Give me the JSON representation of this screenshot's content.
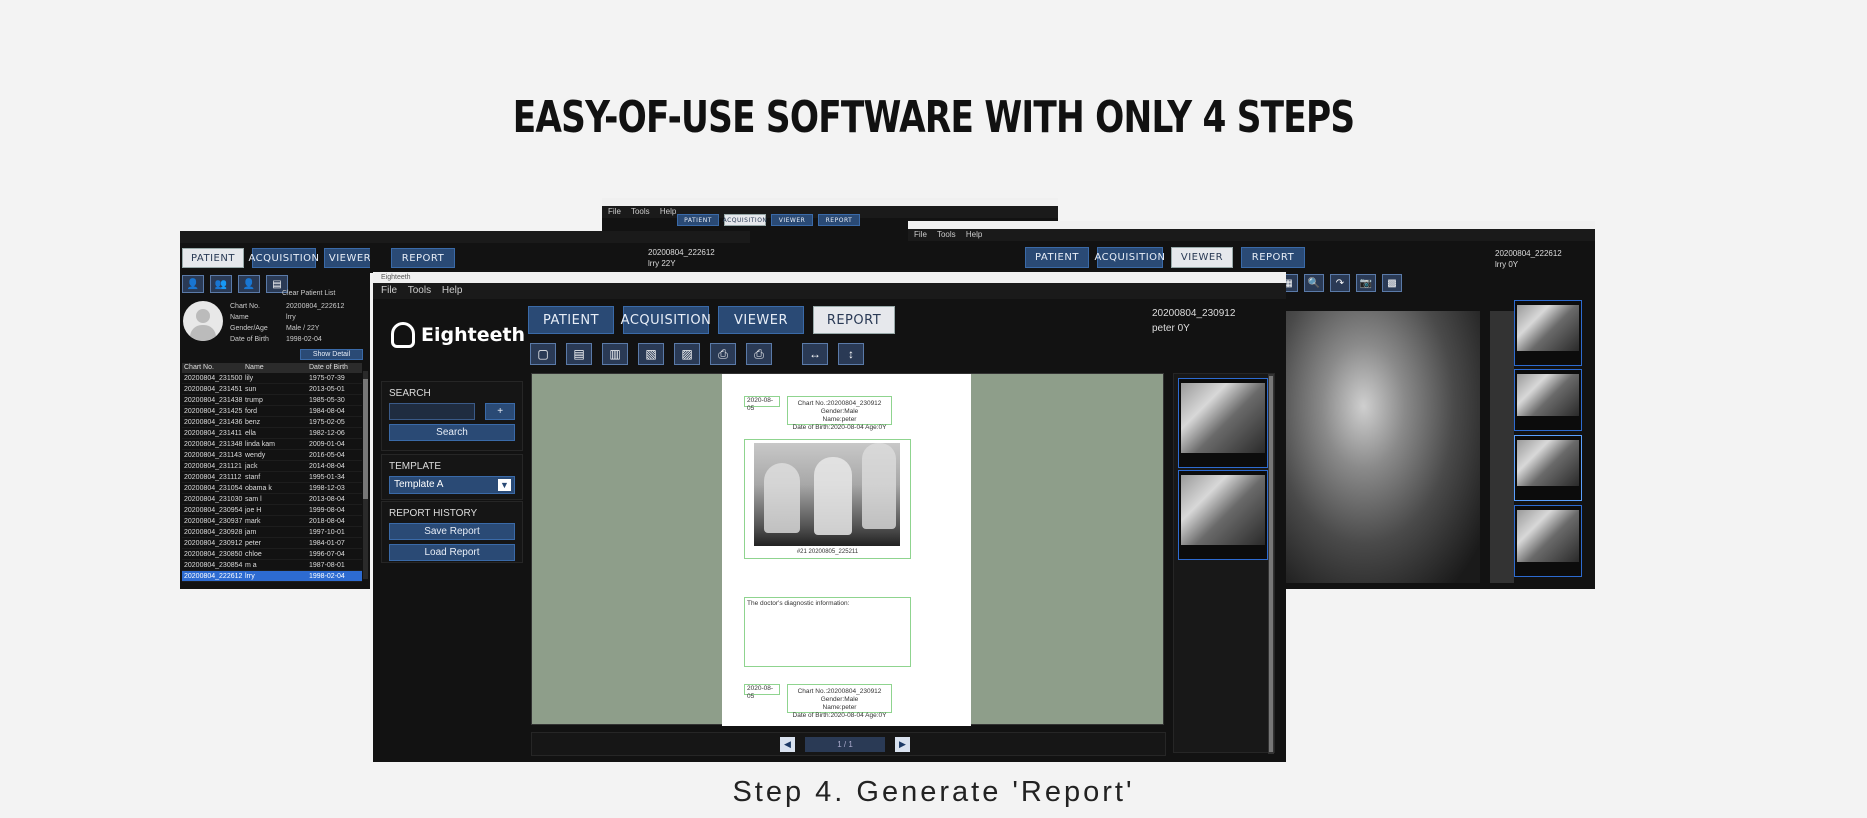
{
  "headline": "EASY-OF-USE SOFTWARE WITH ONLY 4 STEPS",
  "caption": "Step 4. Generate 'Report'",
  "tabs": {
    "patient": "PATIENT",
    "acquisition": "ACQUISITION",
    "viewer": "VIEWER",
    "report": "REPORT"
  },
  "menu": {
    "file": "File",
    "tools": "Tools",
    "help": "Help"
  },
  "left_window": {
    "chart_no": "20200804_222612",
    "patient_line": "lrry 22Y",
    "clear_label": "Clear Patient List",
    "info_labels": [
      "Chart No.",
      "Name",
      "Gender/Age",
      "Date of Birth"
    ],
    "info_values": [
      "20200804_222612",
      "lrry",
      "Male / 22Y",
      "1998-02-04"
    ],
    "show_detail": "Show Detail",
    "columns": [
      "Chart No.",
      "Name",
      "Date of Birth"
    ],
    "rows": [
      [
        "20200804_231500",
        "lily",
        "1975-07-39"
      ],
      [
        "20200804_231451",
        "sun",
        "2013-05-01"
      ],
      [
        "20200804_231438",
        "trump",
        "1985-05-30"
      ],
      [
        "20200804_231425",
        "ford",
        "1984-08-04"
      ],
      [
        "20200804_231436",
        "benz",
        "1975-02-05"
      ],
      [
        "20200804_231411",
        "ella",
        "1982-12-06"
      ],
      [
        "20200804_231348",
        "linda kam",
        "2009-01-04"
      ],
      [
        "20200804_231143",
        "wendy",
        "2016-05-04"
      ],
      [
        "20200804_231121",
        "jack",
        "2014-08-04"
      ],
      [
        "20200804_231112",
        "stanf",
        "1995-01-34"
      ],
      [
        "20200804_231054",
        "obama k",
        "1998-12-03"
      ],
      [
        "20200804_231030",
        "sam l",
        "2013-08-04"
      ],
      [
        "20200804_230954",
        "joe H",
        "1999-08-04"
      ],
      [
        "20200804_230937",
        "mark",
        "2018-08-04"
      ],
      [
        "20200804_230928",
        "jam",
        "1997-10-01"
      ],
      [
        "20200804_230912",
        "peter",
        "1984-01-07"
      ],
      [
        "20200804_230850",
        "chloe",
        "1996-07-04"
      ],
      [
        "20200804_230854",
        "m a",
        "1987-08-01"
      ],
      [
        "20200804_222612",
        "lrry",
        "1998-02-04"
      ]
    ]
  },
  "right_window": {
    "chart_no": "20200804_222612",
    "patient_line": "lrry 0Y"
  },
  "main_window": {
    "title": "Eighteeth",
    "brand": "Eighteeth",
    "chart_no": "20200804_230912",
    "patient_line": "peter 0Y",
    "search_title": "SEARCH",
    "add_label": "+",
    "search_button": "Search",
    "template_title": "TEMPLATE",
    "template_value": "Template A",
    "history_title": "REPORT HISTORY",
    "save_button": "Save Report",
    "load_button": "Load Report",
    "doc_date": "2020-08-05",
    "doc_header_line1": "Chart No.:20200804_230912  Gender:Male",
    "doc_header_line2": "Name:peter",
    "doc_header_line3": "Date of Birth:2020-08-04  Age:0Y",
    "doc_image_caption": "#21 20200805_225211",
    "doc_diagnosis": "The doctor's diagnostic information:",
    "page_indicator": "1 / 1"
  }
}
